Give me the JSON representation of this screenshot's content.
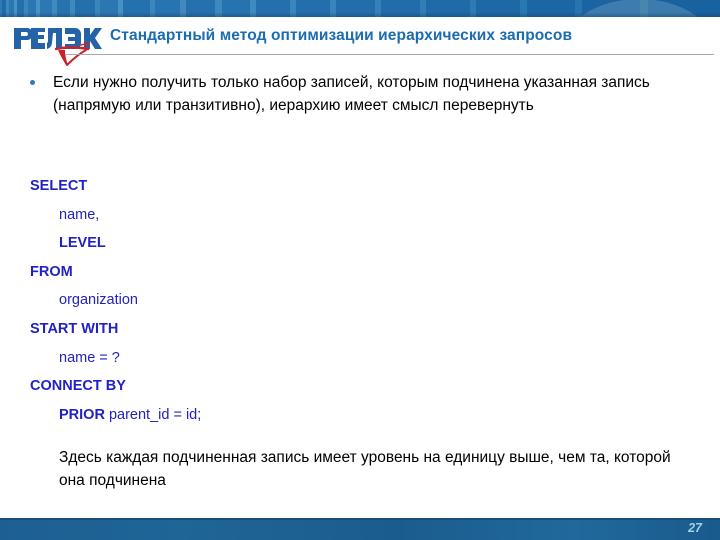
{
  "slide": {
    "title": "Стандартный метод оптимизации иерархических запросов",
    "logo_text": "РЕЛЭКС",
    "page_number": "27"
  },
  "bullet": {
    "text": "Если нужно получить только набор записей, которым подчинена указанная запись (напрямую или транзитивно), иерархию имеет смысл перевернуть"
  },
  "sql": {
    "lines": [
      {
        "indent": false,
        "keyword": "SELECT",
        "rest": ""
      },
      {
        "indent": true,
        "keyword": "",
        "rest": "name,"
      },
      {
        "indent": true,
        "keyword": "LEVEL",
        "rest": ""
      },
      {
        "indent": false,
        "keyword": "FROM",
        "rest": ""
      },
      {
        "indent": true,
        "keyword": "",
        "rest": "organization"
      },
      {
        "indent": false,
        "keyword": "START WITH",
        "rest": ""
      },
      {
        "indent": true,
        "keyword": "",
        "rest": "name = ?"
      },
      {
        "indent": false,
        "keyword": "CONNECT BY",
        "rest": ""
      },
      {
        "indent": true,
        "keyword": "PRIOR",
        "rest": " parent_id = id;"
      }
    ]
  },
  "closing": {
    "text": "Здесь каждая подчиненная запись имеет уровень на единицу выше, чем та, которой она подчинена"
  },
  "colors": {
    "title_blue": "#1B6CB0",
    "sql_blue": "#2222C2",
    "logo_blue": "#2463A8",
    "logo_red": "#C8232B",
    "bar_blue": "#1F6BA8",
    "footer_blue": "#1D5F93",
    "page_number_blue": "#9FD0EE",
    "bullet_dot_blue": "#2E7AB8"
  }
}
